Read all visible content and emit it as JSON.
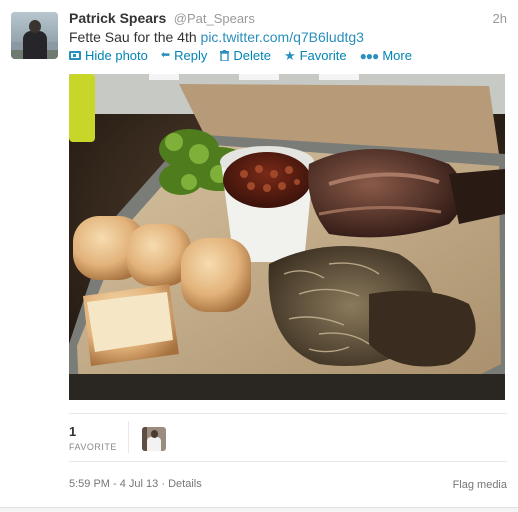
{
  "tweet": {
    "fullname": "Patrick Spears",
    "username": "@Pat_Spears",
    "time": "2h",
    "text": "Fette Sau for the 4th",
    "link": "pic.twitter.com/q7B6ludtg3"
  },
  "actions": [
    {
      "label": "Hide photo",
      "icon": "photo-icon"
    },
    {
      "label": "Reply",
      "icon": "reply-icon"
    },
    {
      "label": "Delete",
      "icon": "trash-icon"
    },
    {
      "label": "Favorite",
      "icon": "star-icon"
    },
    {
      "label": "More",
      "icon": "more-icon"
    }
  ],
  "stats": {
    "favorite_count": "1",
    "favorite_label": "FAVORITE"
  },
  "footer": {
    "timestamp": "5:59 PM - 4 Jul 13",
    "separator": "·",
    "details": "Details",
    "flag": "Flag media"
  },
  "colors": {
    "link": "#2a8fbd",
    "text": "#333333",
    "muted": "#999999"
  }
}
